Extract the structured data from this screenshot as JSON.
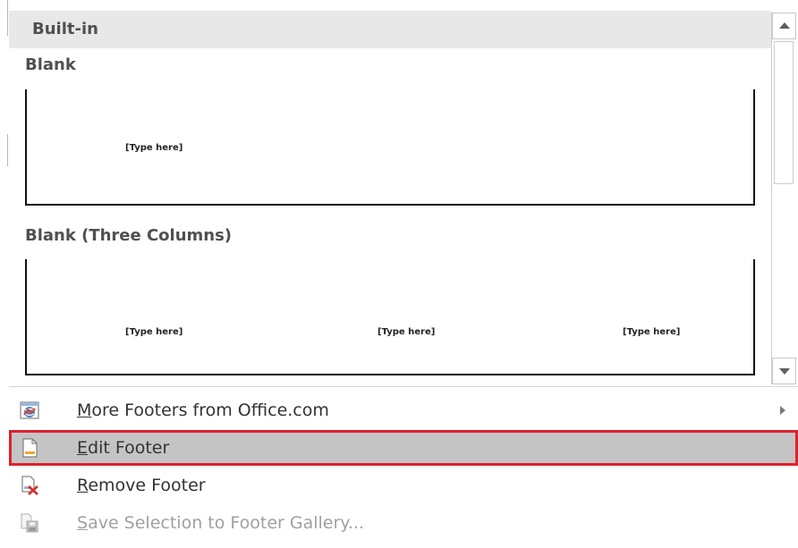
{
  "gallery": {
    "section_header": "Built-in",
    "items": [
      {
        "title": "Blank",
        "placeholders": [
          "[Type here]"
        ]
      },
      {
        "title": "Blank (Three Columns)",
        "placeholders": [
          "[Type here]",
          "[Type here]",
          "[Type here]"
        ]
      }
    ]
  },
  "menu": {
    "more_footers": {
      "accel": "M",
      "rest": "ore Footers from Office.com",
      "icon": "globe-icon"
    },
    "edit_footer": {
      "accel": "E",
      "rest": "dit Footer",
      "icon": "document-icon"
    },
    "remove_footer": {
      "accel": "R",
      "rest": "emove Footer",
      "icon": "remove-icon"
    },
    "save_selection": {
      "accel": "S",
      "rest": "ave Selection to Footer Gallery...",
      "icon": "save-icon"
    }
  },
  "colors": {
    "selection_outline": "#e0202e",
    "selected_background": "#c4c4c4",
    "header_background": "#e8e8e8"
  }
}
